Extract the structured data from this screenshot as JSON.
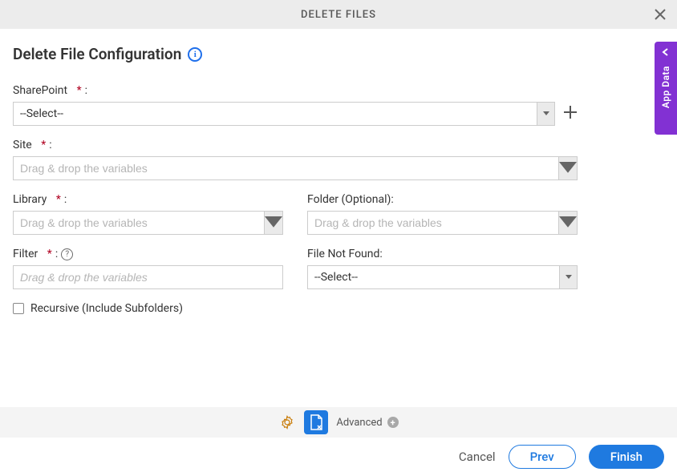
{
  "header": {
    "title": "DELETE FILES"
  },
  "page_title": "Delete File Configuration",
  "sidebar_tab": "App Data",
  "fields": {
    "sharepoint": {
      "label": "SharePoint",
      "value": "--Select--"
    },
    "site": {
      "label": "Site",
      "placeholder": "Drag & drop the variables"
    },
    "library": {
      "label": "Library",
      "placeholder": "Drag & drop the variables"
    },
    "folder": {
      "label": "Folder (Optional):",
      "placeholder": "Drag & drop the variables"
    },
    "filter": {
      "label": "Filter",
      "placeholder": "Drag & drop the variables"
    },
    "file_not_found": {
      "label": "File Not Found:",
      "value": "--Select--"
    },
    "recursive": {
      "label": "Recursive (Include Subfolders)"
    }
  },
  "footer": {
    "advanced_label": "Advanced",
    "cancel": "Cancel",
    "prev": "Prev",
    "finish": "Finish"
  }
}
